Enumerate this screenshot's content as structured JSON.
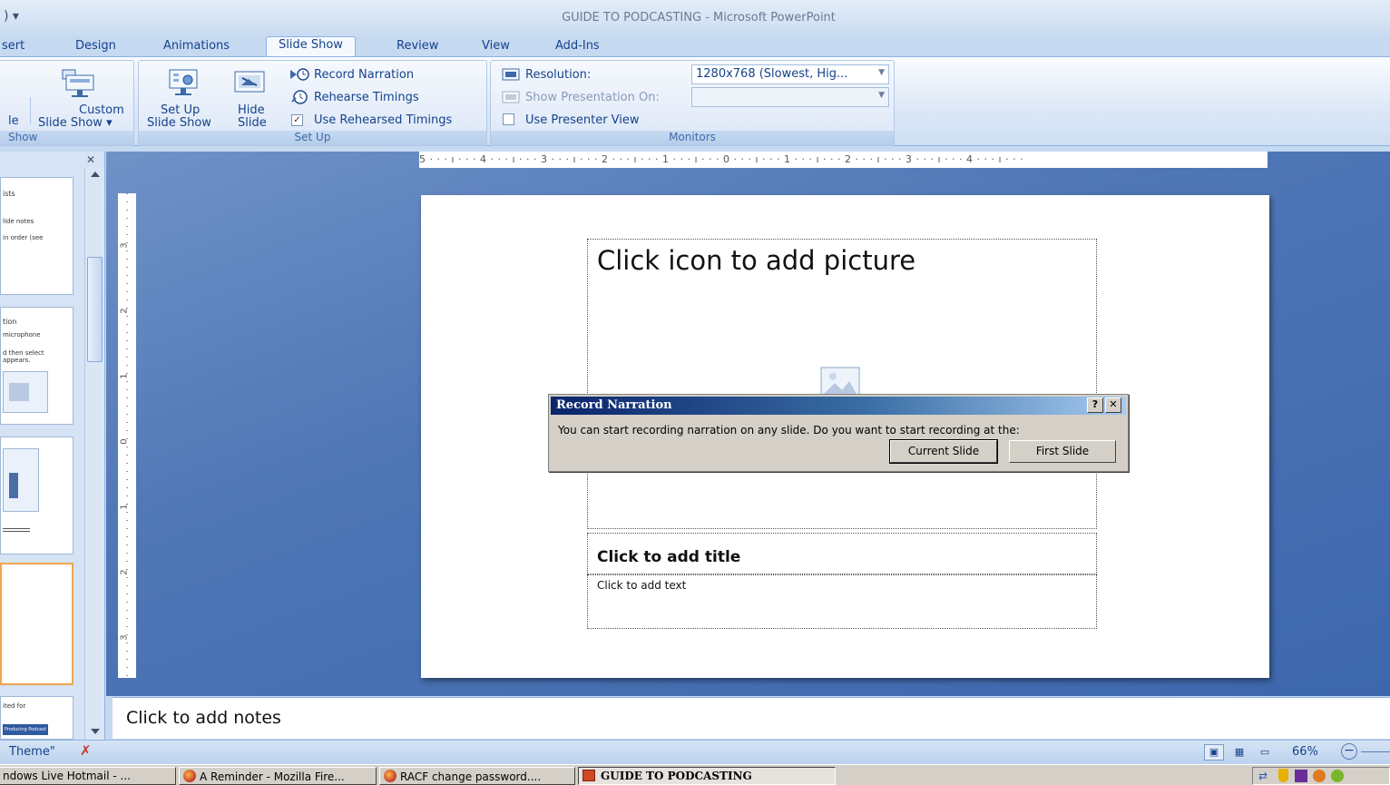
{
  "window": {
    "title": "GUIDE TO PODCASTING - Microsoft PowerPoint",
    "qat": ") ▾"
  },
  "tabs": [
    {
      "label": "sert"
    },
    {
      "label": "Design"
    },
    {
      "label": "Animations"
    },
    {
      "label": "Slide Show",
      "active": true
    },
    {
      "label": "Review"
    },
    {
      "label": "View"
    },
    {
      "label": "Add-Ins"
    }
  ],
  "ribbon": {
    "start_group": {
      "label": "Show",
      "button_partial": "le",
      "custom_slide_show": [
        "Custom",
        "Slide Show ▾"
      ]
    },
    "setup_group": {
      "label": "Set Up",
      "set_up_slide_show": [
        "Set Up",
        "Slide Show"
      ],
      "hide_slide": [
        "Hide",
        "Slide"
      ],
      "record_narration": "Record Narration",
      "rehearse_timings": "Rehearse Timings",
      "use_rehearsed_timings": "Use Rehearsed Timings",
      "use_rehearsed_checked": "✓"
    },
    "monitors_group": {
      "label": "Monitors",
      "resolution_label": "Resolution:",
      "resolution_value": "1280x768 (Slowest, Hig...",
      "show_on_label": "Show Presentation On:",
      "presenter_view": "Use Presenter View"
    }
  },
  "thumbnails": [
    {
      "lines": [
        "ists",
        "",
        "lide notes",
        "in order (see"
      ]
    },
    {
      "lines": [
        "tion",
        "microphone",
        "d then select",
        "appears."
      ]
    },
    {
      "lines": []
    },
    {
      "lines": [],
      "selected": true
    },
    {
      "lines": [
        "ited for",
        "Producing Podcast"
      ]
    }
  ],
  "ruler": {
    "horizontal": "5 · · · ı · · · 4 · · · ı · · · 3 · · · ı · · · 2 · · · ı · · · 1 · · · ı · · · 0 · · · ı · · · 1 · · · ı · · · 2 · · · ı · · · 3 · · · ı · · · 4 · · · ı · · ·",
    "vertical_marks": [
      "3",
      "2",
      "1",
      "0",
      "1",
      "2",
      "3"
    ]
  },
  "slide": {
    "picture_placeholder": "Click icon to add picture",
    "title_placeholder": "Click to add title",
    "text_placeholder": "Click to add text"
  },
  "dialog": {
    "title": "Record Narration",
    "help": "?",
    "close": "✕",
    "message": "You can start recording narration on any slide.  Do you want to start recording at the:",
    "current_slide": "Current Slide",
    "first_slide": "First Slide"
  },
  "notes": {
    "placeholder": "Click to add notes"
  },
  "statusbar": {
    "theme": "Theme\"",
    "zoom": "66%"
  },
  "taskbar": {
    "items": [
      {
        "label": "ndows Live Hotmail - ..."
      },
      {
        "label": "A Reminder - Mozilla Fire..."
      },
      {
        "label": "RACF change password...."
      },
      {
        "label": "GUIDE TO PODCASTING",
        "active": true
      }
    ]
  }
}
